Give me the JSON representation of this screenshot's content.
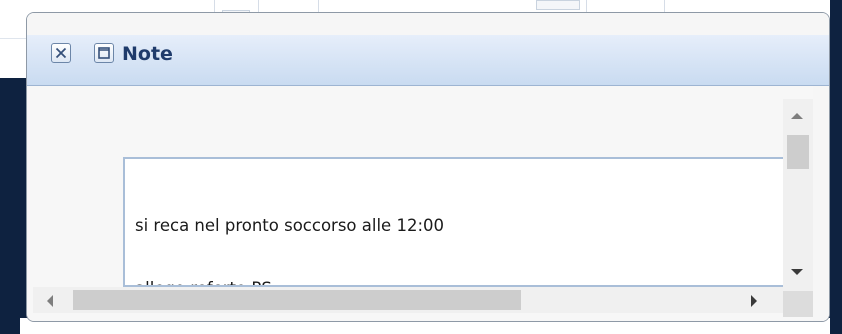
{
  "window": {
    "title": "Note",
    "close_icon": "close-icon",
    "maximize_icon": "maximize-icon"
  },
  "note": {
    "lines": [
      "si reca nel pronto soccorso alle 12:00",
      "allego referto PS"
    ]
  },
  "colors": {
    "title_text": "#1f3b6b",
    "titlebar": "#c9dbf1",
    "textarea_border": "#a9bed8",
    "background_app": "#0e2240"
  }
}
